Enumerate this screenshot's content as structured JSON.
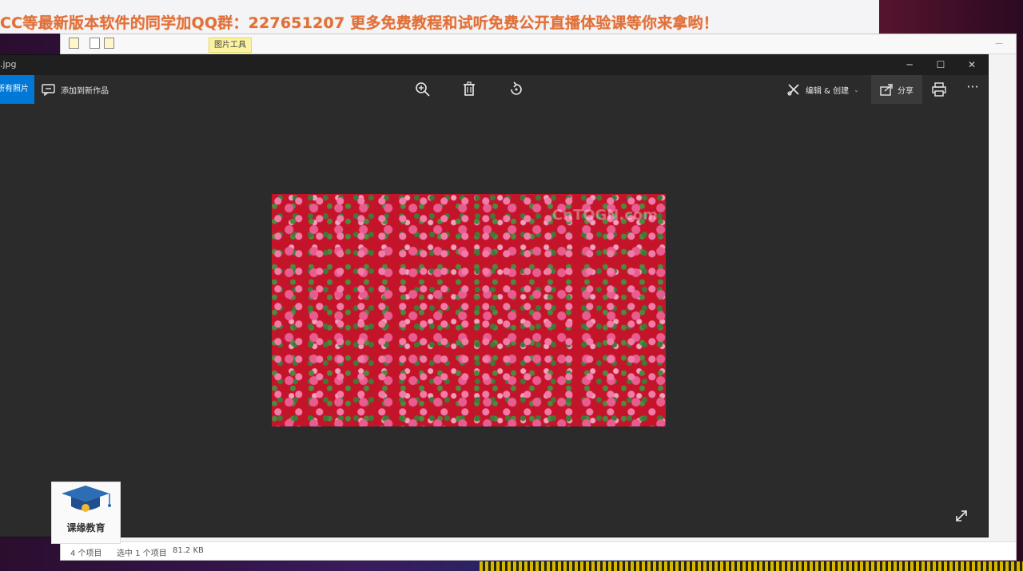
{
  "banner": {
    "text": "CC等最新版本软件的同学加QQ群：227651207 更多免费教程和试听免费公开直播体验课等你来拿哟！"
  },
  "explorer": {
    "context_tab": "图片工具",
    "status_items": "4 个项目",
    "status_selected": "选中 1 个项目",
    "status_size": "81.2 KB"
  },
  "photos": {
    "title": ".jpg",
    "toolbar": {
      "view_all": "查看所有照片",
      "add_to": "添加到新作品",
      "edit_create": "编辑 & 创建",
      "share": "分享"
    },
    "photo_watermark": "CnTOGN.com"
  },
  "logo": {
    "name": "课缘教育"
  },
  "colors": {
    "accent": "#0078d7",
    "banner_text": "#e0703a"
  }
}
